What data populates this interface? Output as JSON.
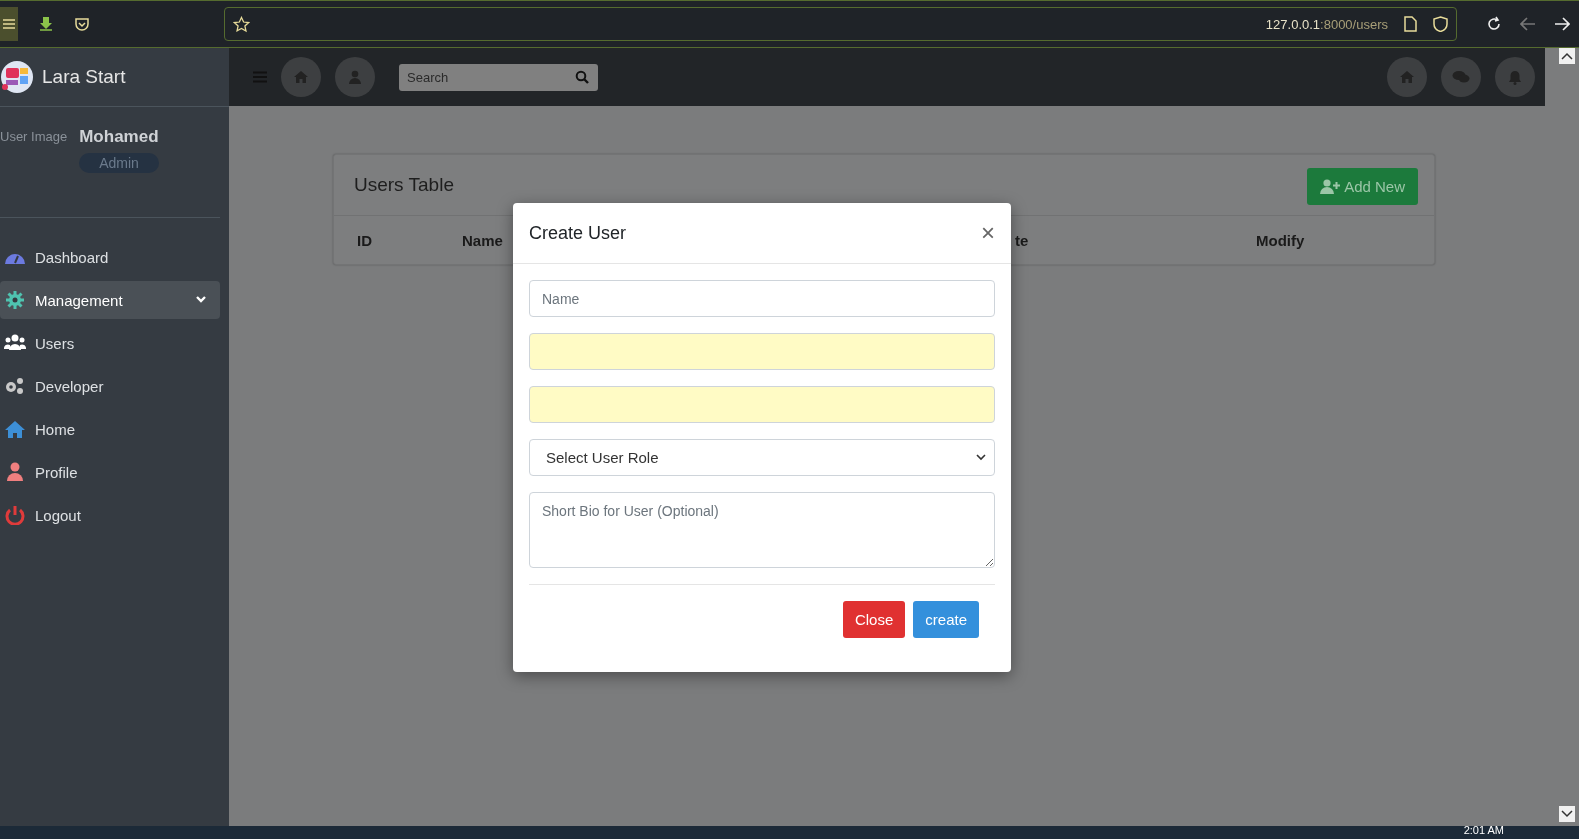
{
  "browser": {
    "url_host": "127.0.0.1",
    "url_rest": ":8000/users"
  },
  "sidebar": {
    "brand": "Lara Start",
    "user_image_alt": "User Image",
    "user_name": "Mohamed",
    "user_role": "Admin",
    "items": [
      {
        "label": "Dashboard",
        "kind": "link",
        "selected": false
      },
      {
        "label": "Management",
        "kind": "treeview",
        "selected": true
      },
      {
        "label": "Users",
        "kind": "link",
        "selected": false
      },
      {
        "label": "Developer",
        "kind": "link",
        "selected": false
      },
      {
        "label": "Home",
        "kind": "link",
        "selected": false
      },
      {
        "label": "Profile",
        "kind": "link",
        "selected": false
      },
      {
        "label": "Logout",
        "kind": "link",
        "selected": false
      }
    ]
  },
  "navbar": {
    "search": {
      "placeholder": "Search"
    }
  },
  "card": {
    "title": "Users Table",
    "add_button": "Add New",
    "columns": [
      "ID",
      "Name",
      "te",
      "Modify"
    ]
  },
  "modal": {
    "title": "Create User",
    "close_symbol": "×",
    "fields": [
      {
        "kind": "input",
        "placeholder": "Name",
        "autofilled": false
      },
      {
        "kind": "input",
        "autofilled": true
      },
      {
        "kind": "input",
        "autofilled": true
      },
      {
        "kind": "select",
        "value": "Select User Role"
      },
      {
        "kind": "textarea",
        "placeholder": "Short Bio for User (Optional)"
      }
    ],
    "buttons": [
      {
        "label": "Close",
        "kind": "danger"
      },
      {
        "label": "create",
        "kind": "primary"
      }
    ]
  },
  "taskbar": {
    "time": "2:01 AM"
  }
}
